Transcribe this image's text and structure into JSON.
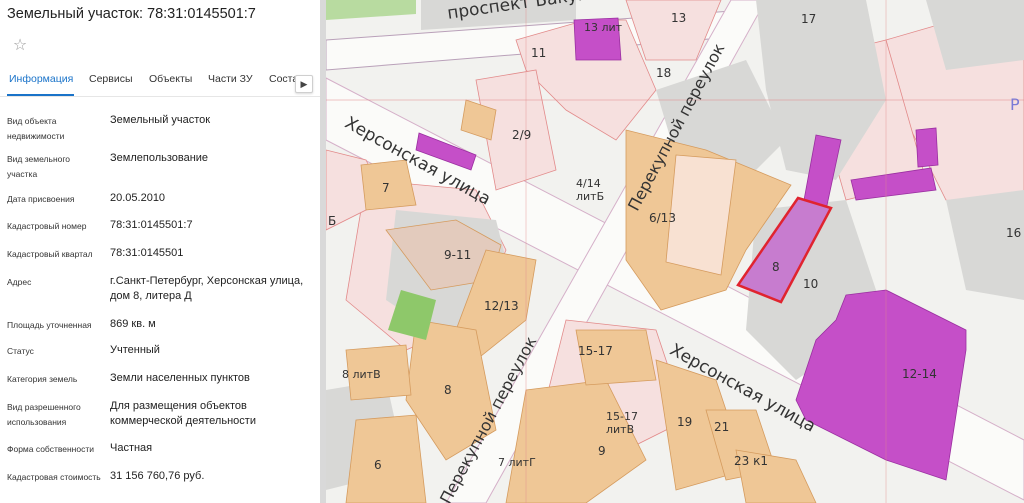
{
  "panel": {
    "title": "Земельный участок: 78:31:0145501:7",
    "tabs": [
      "Информация",
      "Сервисы",
      "Объекты",
      "Части ЗУ",
      "Соста"
    ],
    "rows": [
      {
        "label": "Вид объекта недвижимости",
        "value": "Земельный участок"
      },
      {
        "label": "Вид земельного участка",
        "value": "Землепользование"
      },
      {
        "label": "Дата присвоения",
        "value": "20.05.2010"
      },
      {
        "label": "Кадастровый номер",
        "value": "78:31:0145501:7"
      },
      {
        "label": "Кадастровый квартал",
        "value": "78:31:0145501"
      },
      {
        "label": "Адрес",
        "value": "г.Санкт-Петербург, Херсонская улица, дом 8, литера Д"
      },
      {
        "label": "Площадь уточненная",
        "value": "869 кв. м"
      },
      {
        "label": "Статус",
        "value": "Учтенный"
      },
      {
        "label": "Категория земель",
        "value": "Земли населенных пунктов"
      },
      {
        "label": "Вид разрешенного использования",
        "value": "Для размещения объектов коммерческой деятельности"
      },
      {
        "label": "Форма собственности",
        "value": "Частная"
      },
      {
        "label": "Кадастровая стоимость",
        "value": "31 156 760,76 руб."
      }
    ],
    "icons": {
      "favorite": "star-outline-icon",
      "tabs_scroll": "chevron-right-icon"
    }
  },
  "map": {
    "streets": {
      "bakunina": "проспект Бакунина",
      "khersonskaya_left": "Херсонская улица",
      "khersonskaya_right": "Херсонская улица",
      "perekupnoy_top": "Перекупной переулок",
      "perekupnoy_bottom": "Перекупной переулок"
    },
    "buildings": [
      "13 лит",
      "13",
      "17",
      "11",
      "18",
      "2/9",
      "4/14 литБ",
      "6/13",
      "8",
      "10",
      "16",
      "7",
      "9-11",
      "12/13",
      "Б",
      "8 литВ",
      "8",
      "15-17",
      "15-17 литВ",
      "19",
      "21",
      "12-14",
      "7 литГ",
      "9",
      "6",
      "23 к1",
      "Р"
    ],
    "colors": {
      "selected": "#e0242f",
      "magenta": "#c54fc8",
      "building": "#efc796",
      "green": "#8ec86a",
      "parcel": "#f6e0df"
    }
  }
}
